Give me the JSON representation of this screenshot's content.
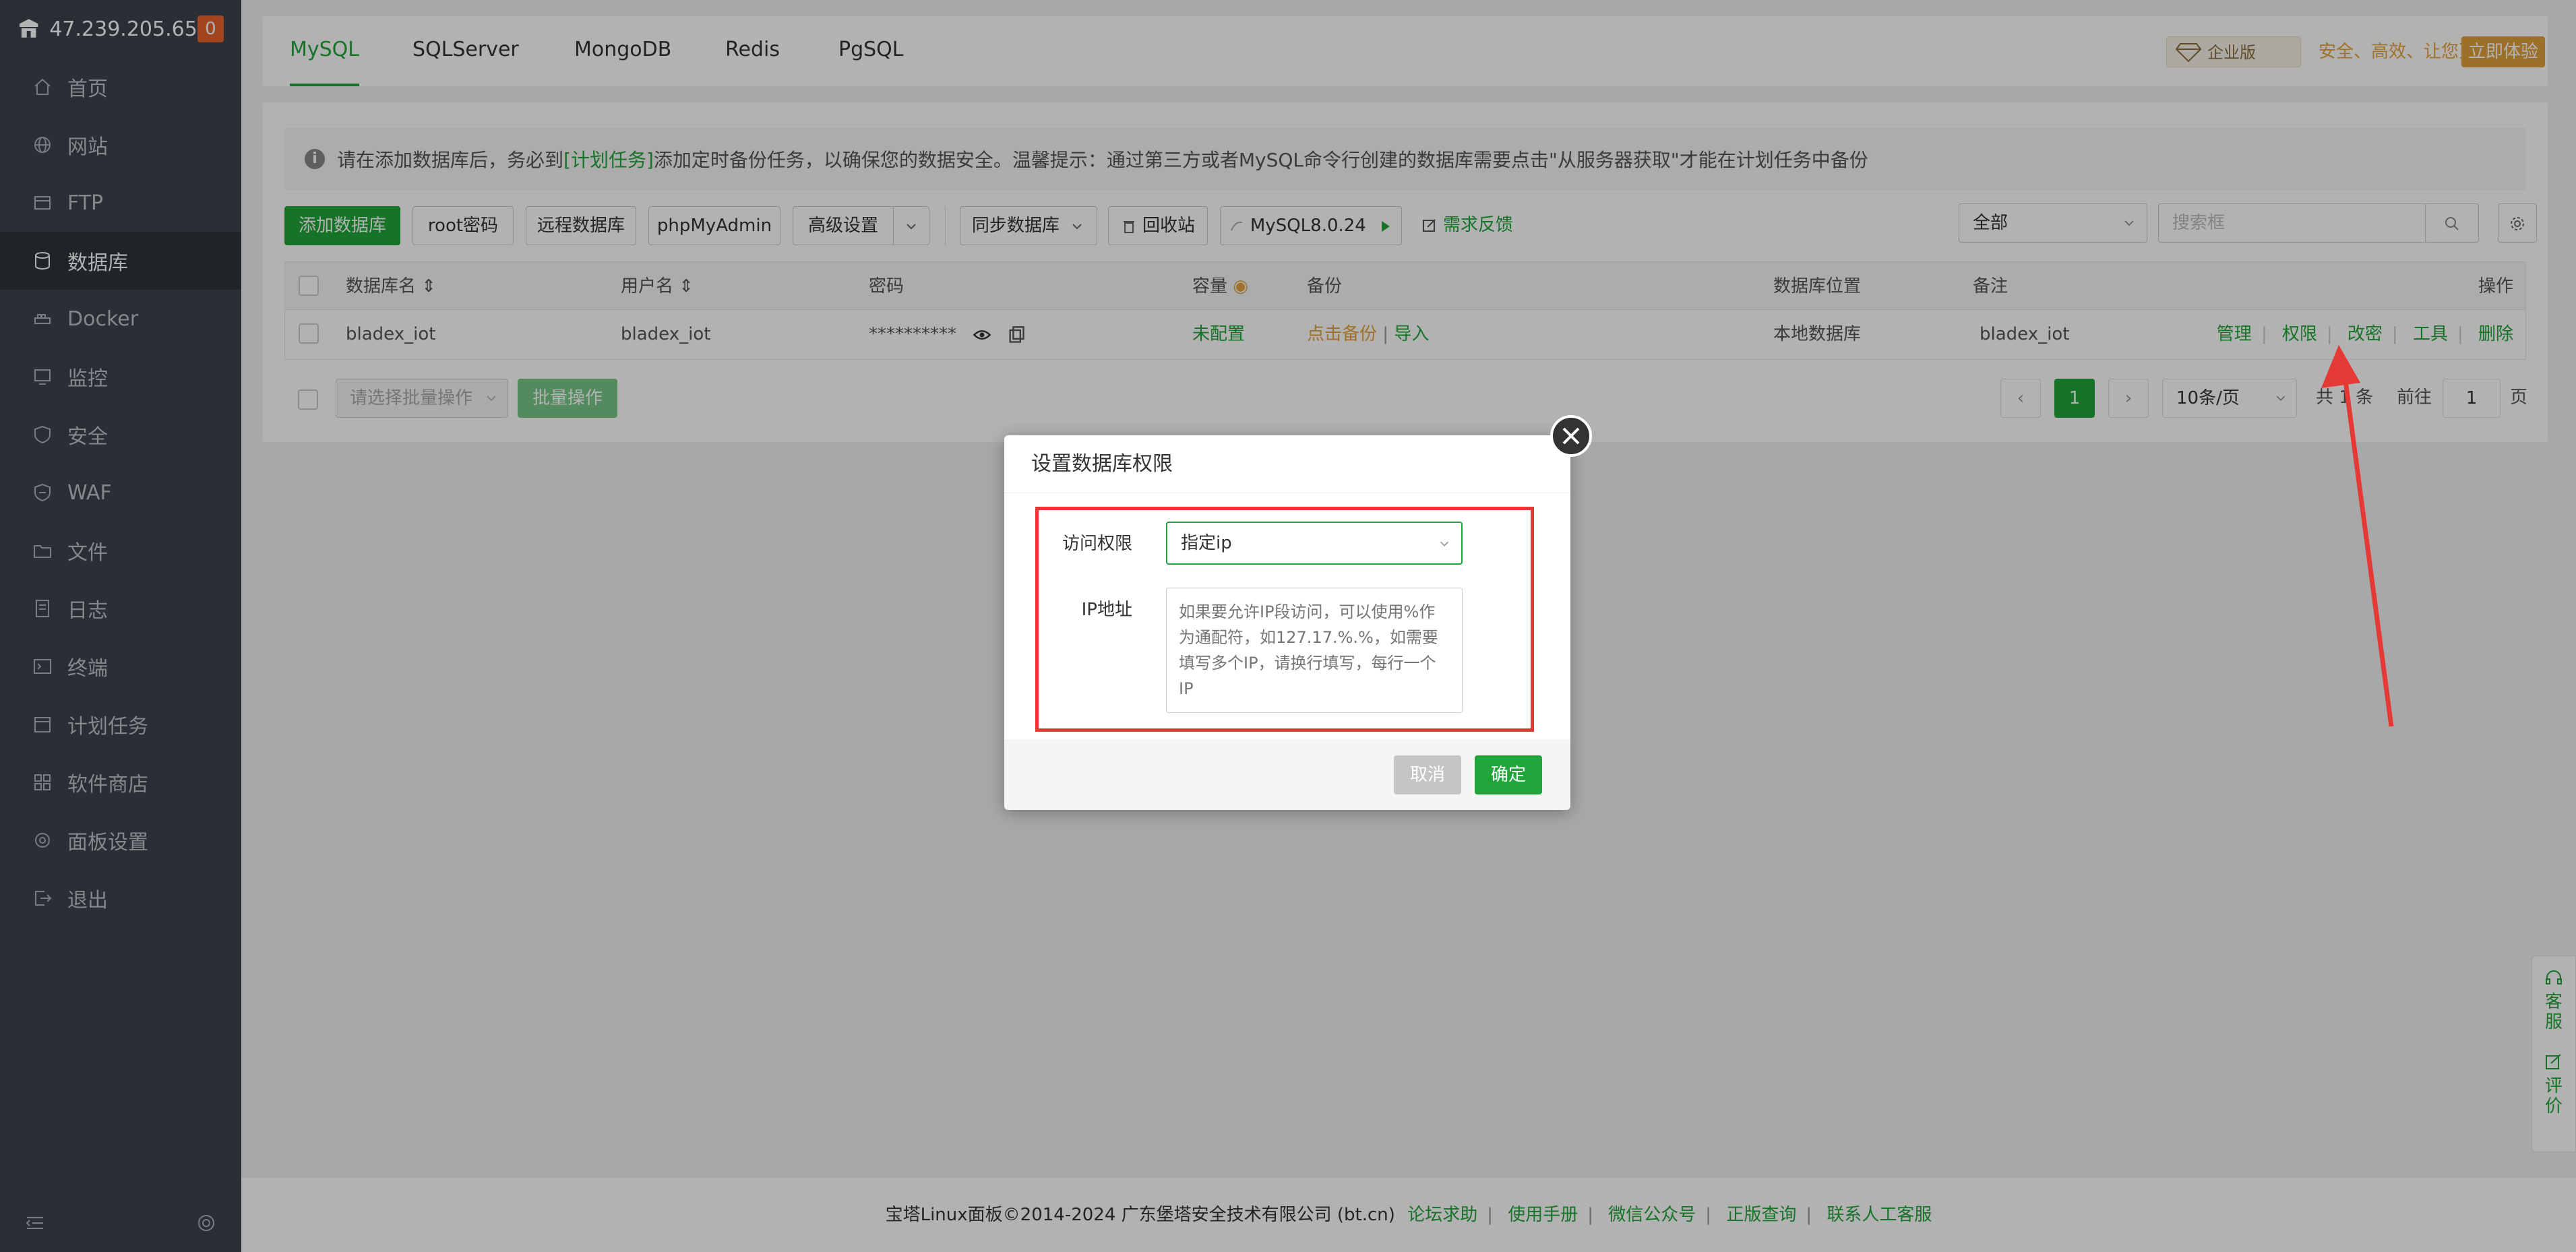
{
  "sidebar": {
    "ip": "47.239.205.65",
    "badge": "0",
    "items": [
      {
        "label": "首页",
        "icon": "home-icon"
      },
      {
        "label": "网站",
        "icon": "globe-icon"
      },
      {
        "label": "FTP",
        "icon": "ftp-icon"
      },
      {
        "label": "数据库",
        "icon": "database-icon"
      },
      {
        "label": "Docker",
        "icon": "docker-icon"
      },
      {
        "label": "监控",
        "icon": "monitor-icon"
      },
      {
        "label": "安全",
        "icon": "shield-icon"
      },
      {
        "label": "WAF",
        "icon": "waf-icon"
      },
      {
        "label": "文件",
        "icon": "folder-icon"
      },
      {
        "label": "日志",
        "icon": "log-icon"
      },
      {
        "label": "终端",
        "icon": "terminal-icon"
      },
      {
        "label": "计划任务",
        "icon": "clock-icon"
      },
      {
        "label": "软件商店",
        "icon": "store-icon"
      },
      {
        "label": "面板设置",
        "icon": "gear-icon"
      },
      {
        "label": "退出",
        "icon": "logout-icon"
      }
    ]
  },
  "tabs": [
    "MySQL",
    "SQLServer",
    "MongoDB",
    "Redis",
    "PgSQL"
  ],
  "promo": {
    "edition": "企业版",
    "slogan": "安全、高效、让您更安心",
    "button": "立即体验"
  },
  "notice": {
    "before": "请在添加数据库后，务必到",
    "link": "[计划任务]",
    "after": "添加定时备份任务，以确保您的数据安全。温馨提示：通过第三方或者MySQL命令行创建的数据库需要点击\"从服务器获取\"才能在计划任务中备份"
  },
  "toolbar": {
    "add_db": "添加数据库",
    "root_pwd": "root密码",
    "remote_db": "远程数据库",
    "phpmyadmin": "phpMyAdmin",
    "advanced": "高级设置",
    "sync_db": "同步数据库",
    "recycle": "回收站",
    "version": "MySQL8.0.24",
    "feedback": "需求反馈",
    "filter": "全部",
    "search_placeholder": "搜索框"
  },
  "table": {
    "headers": {
      "name": "数据库名",
      "user": "用户名",
      "password": "密码",
      "capacity": "容量",
      "backup": "备份",
      "location": "数据库位置",
      "remark": "备注",
      "ops": "操作"
    },
    "row": {
      "name": "bladex_iot",
      "user": "bladex_iot",
      "password": "**********",
      "capacity": "未配置",
      "backup": "点击备份",
      "import": "导入",
      "location": "本地数据库",
      "remark": "bladex_iot",
      "ops": [
        "管理",
        "权限",
        "改密",
        "工具",
        "删除"
      ]
    }
  },
  "batch": {
    "placeholder": "请选择批量操作",
    "button": "批量操作"
  },
  "pager": {
    "page": "1",
    "per_page": "10条/页",
    "total_prefix": "共",
    "total_count": "1",
    "total_suffix": "条",
    "goto": "前往",
    "goto_value": "1",
    "page_suffix": "页"
  },
  "footer": {
    "copyright": "宝塔Linux面板©2014-2024 广东堡塔安全技术有限公司 (bt.cn)",
    "links": [
      "论坛求助",
      "使用手册",
      "微信公众号",
      "正版查询",
      "联系人工客服"
    ]
  },
  "side_tools": [
    "客服",
    "评价"
  ],
  "dialog": {
    "title": "设置数据库权限",
    "access_label": "访问权限",
    "access_value": "指定ip",
    "ip_label": "IP地址",
    "ip_placeholder": "如果要允许IP段访问，可以使用%作为通配符，如127.17.%.%，如需要填写多个IP，请换行填写，每行一个IP",
    "cancel": "取消",
    "confirm": "确定"
  },
  "colors": {
    "accent": "#20a53a",
    "sidebar": "#3c444d",
    "annotation": "#e53935"
  }
}
